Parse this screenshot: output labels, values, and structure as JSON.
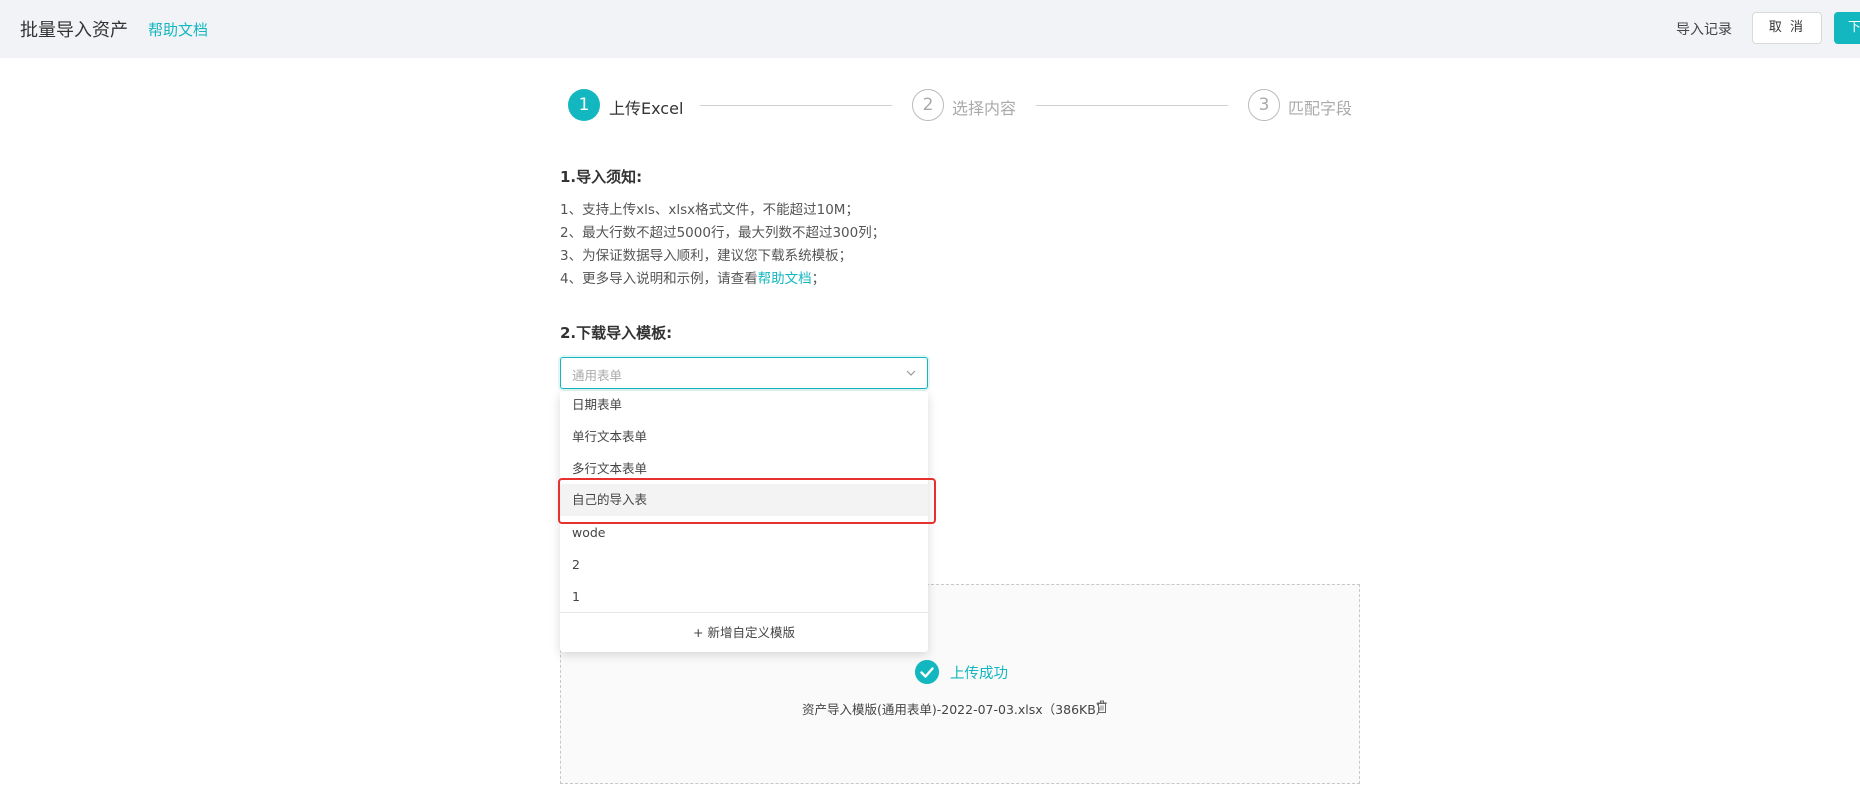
{
  "header": {
    "title": "批量导入资产",
    "help_link": "帮助文档",
    "records_link": "导入记录",
    "cancel_button": "取 消",
    "next_button": "下"
  },
  "steps": [
    {
      "number": "1",
      "label": "上传Excel",
      "state": "active"
    },
    {
      "number": "2",
      "label": "选择内容",
      "state": "inactive"
    },
    {
      "number": "3",
      "label": "匹配字段",
      "state": "inactive"
    }
  ],
  "notice": {
    "title": "1.导入须知:",
    "lines": [
      "1、支持上传xls、xlsx格式文件，不能超过10M；",
      "2、最大行数不超过5000行，最大列数不超过300列；",
      "3、为保证数据导入顺利，建议您下载系统模板；"
    ],
    "line4_prefix": "4、更多导入说明和示例，请查看",
    "line4_link": "帮助文档",
    "line4_suffix": "；"
  },
  "template": {
    "title": "2.下载导入模板:",
    "select_placeholder": "通用表单",
    "options": [
      "日期表单",
      "单行文本表单",
      "多行文本表单",
      "自己的导入表",
      "wode",
      "2",
      "1"
    ],
    "hovered_option": "自己的导入表",
    "add_custom": "+ 新增自定义模版"
  },
  "upload": {
    "status_text": "上传成功",
    "file_name": "资产导入模版(通用表单)-2022-07-03.xlsx（386KB）"
  },
  "colors": {
    "accent": "#12b7c0",
    "highlight": "#e5322d"
  }
}
